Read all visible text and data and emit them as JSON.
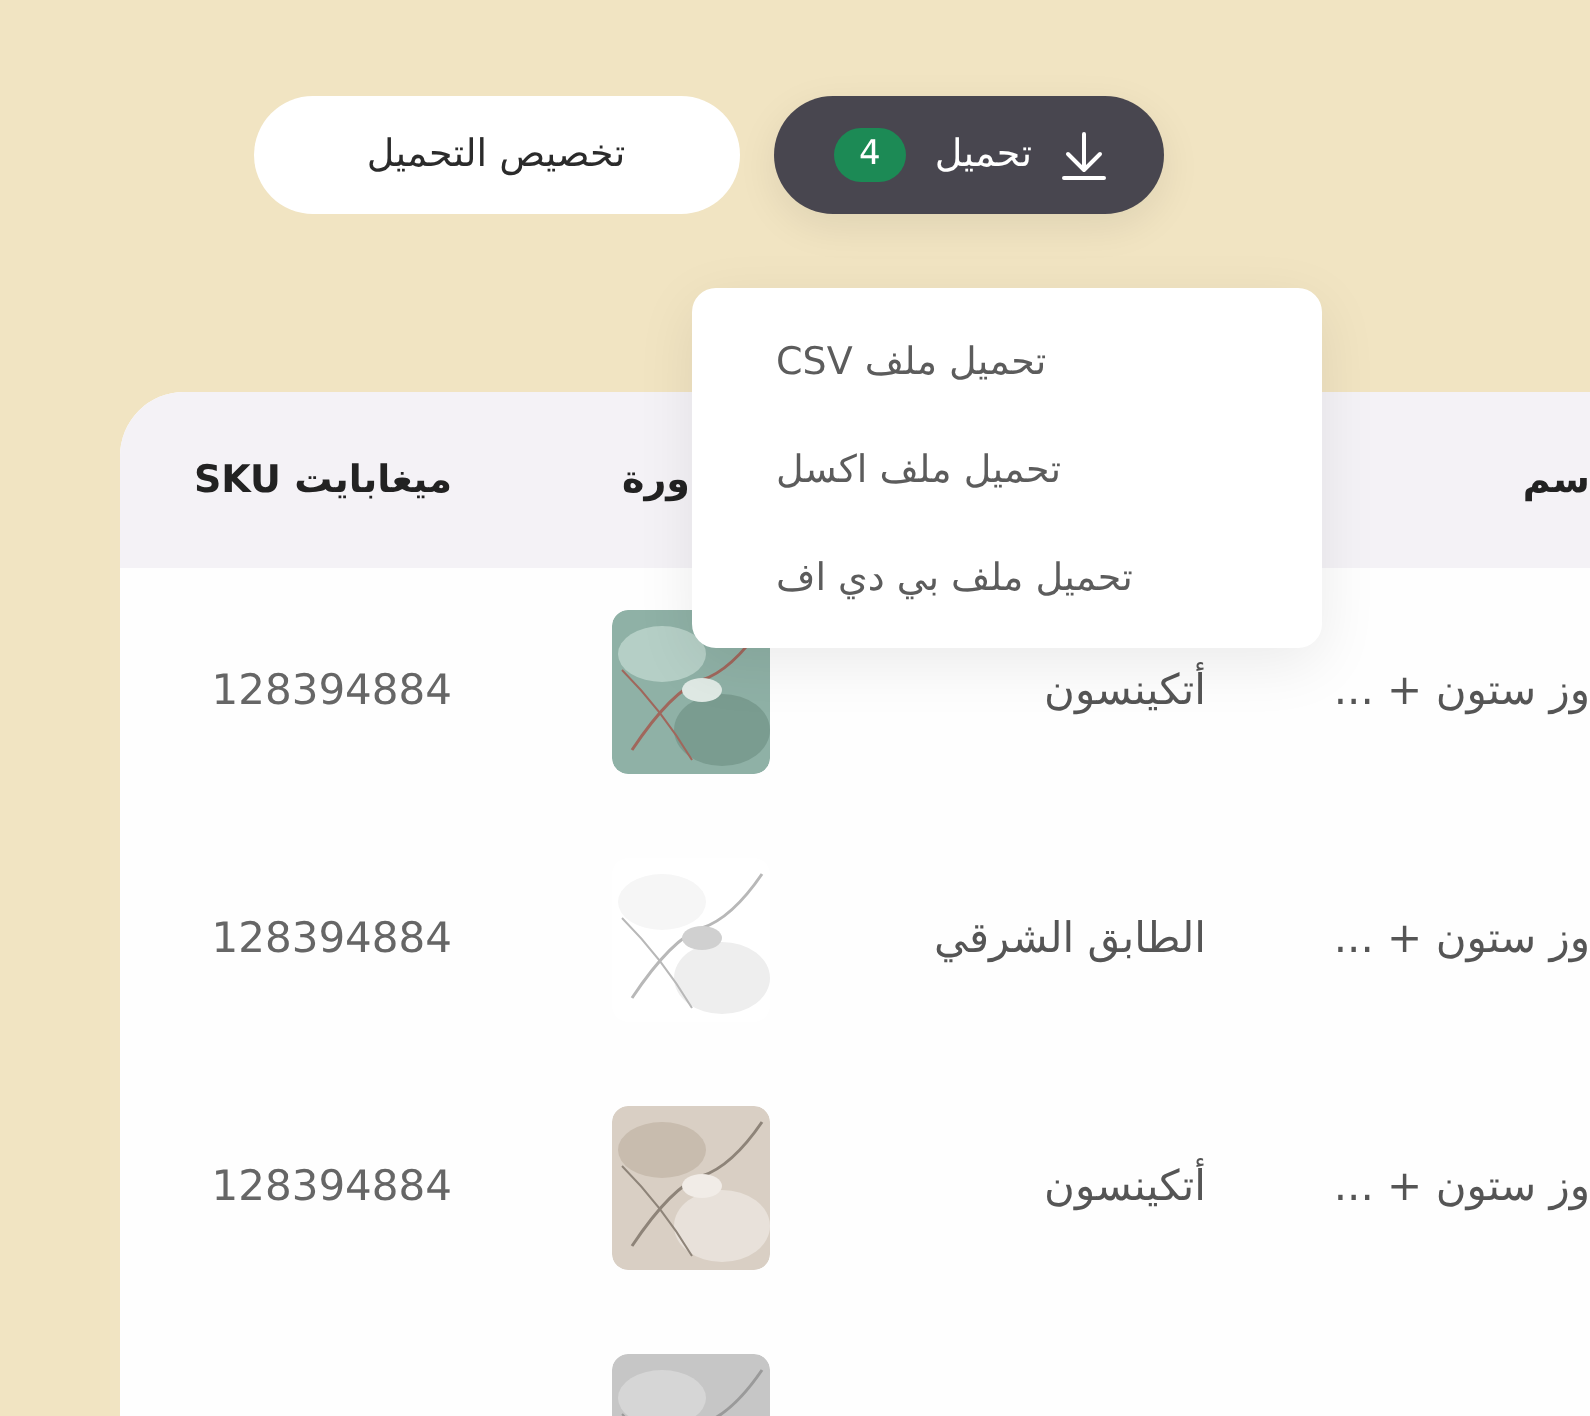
{
  "toolbar": {
    "download_button": {
      "label": "تحميل",
      "count": "4"
    },
    "customize_button": {
      "label": "تخصيص التحميل"
    }
  },
  "download_menu": {
    "items": [
      {
        "label": "تحميل ملف CSV"
      },
      {
        "label": "تحميل ملف اكسل"
      },
      {
        "label": "تحميل ملف بي دي اف"
      }
    ]
  },
  "table": {
    "headers": {
      "column_1": "سم",
      "image": "ورة",
      "sku": "ميغابايت SKU"
    },
    "rows": [
      {
        "column_1": "وز ستون + ...",
        "product": "أتكينسون",
        "image": {
          "kind": "picture"
        },
        "sku": "128394884"
      },
      {
        "column_1": "وز ستون + ...",
        "product": "الطابق الشرقي",
        "image": {
          "kind": "picture"
        },
        "sku": "128394884"
      },
      {
        "column_1": "وز ستون + ...",
        "product": "أتكينسون",
        "image": {
          "kind": "picture"
        },
        "sku": "128394884"
      },
      {
        "image": {
          "kind": "picture"
        }
      }
    ]
  }
}
